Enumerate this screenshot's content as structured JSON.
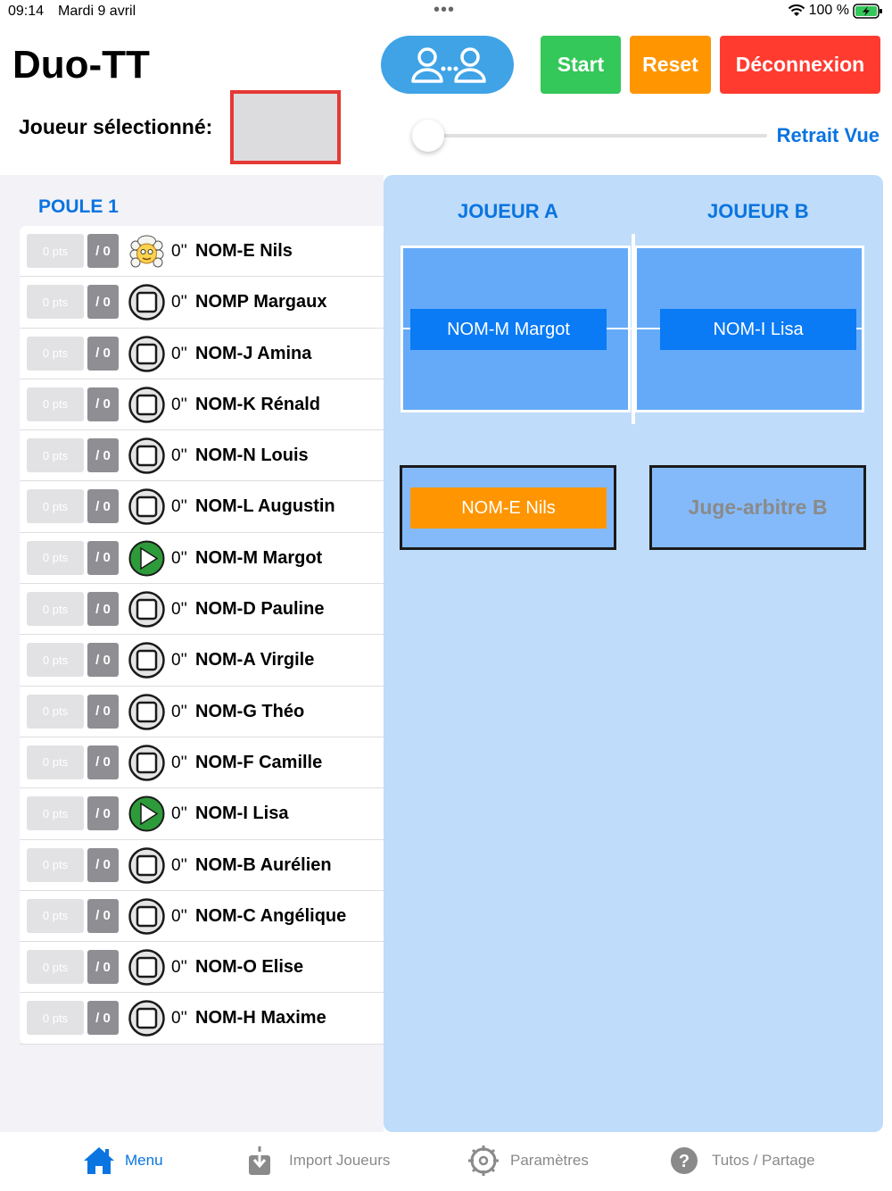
{
  "status_bar": {
    "time": "09:14",
    "date": "Mardi 9 avril",
    "dots": "•••",
    "battery": "100 %"
  },
  "header": {
    "title": "Duo-TT",
    "selected_label": "Joueur sélectionné:",
    "start_label": "Start",
    "reset_label": "Reset",
    "logout_label": "Déconnexion",
    "retrait_label": "Retrait Vue",
    "slider_value": 0
  },
  "pool": {
    "title": "POULE 1",
    "players": [
      {
        "pts": "0 pts",
        "score": "/ 0",
        "time": "0''",
        "name": "NOM-E Nils",
        "status": "judge"
      },
      {
        "pts": "0 pts",
        "score": "/ 0",
        "time": "0''",
        "name": "NOMP Margaux",
        "status": "stop"
      },
      {
        "pts": "0 pts",
        "score": "/ 0",
        "time": "0''",
        "name": "NOM-J Amina",
        "status": "stop"
      },
      {
        "pts": "0 pts",
        "score": "/ 0",
        "time": "0''",
        "name": "NOM-K Rénald",
        "status": "stop"
      },
      {
        "pts": "0 pts",
        "score": "/ 0",
        "time": "0''",
        "name": "NOM-N Louis",
        "status": "stop"
      },
      {
        "pts": "0 pts",
        "score": "/ 0",
        "time": "0''",
        "name": "NOM-L Augustin",
        "status": "stop"
      },
      {
        "pts": "0 pts",
        "score": "/ 0",
        "time": "0''",
        "name": "NOM-M Margot",
        "status": "play"
      },
      {
        "pts": "0 pts",
        "score": "/ 0",
        "time": "0''",
        "name": "NOM-D Pauline",
        "status": "stop"
      },
      {
        "pts": "0 pts",
        "score": "/ 0",
        "time": "0''",
        "name": "NOM-A Virgile",
        "status": "stop"
      },
      {
        "pts": "0 pts",
        "score": "/ 0",
        "time": "0''",
        "name": "NOM-G Théo",
        "status": "stop"
      },
      {
        "pts": "0 pts",
        "score": "/ 0",
        "time": "0''",
        "name": "NOM-F Camille",
        "status": "stop"
      },
      {
        "pts": "0 pts",
        "score": "/ 0",
        "time": "0''",
        "name": "NOM-I Lisa",
        "status": "play"
      },
      {
        "pts": "0 pts",
        "score": "/ 0",
        "time": "0''",
        "name": "NOM-B Aurélien",
        "status": "stop"
      },
      {
        "pts": "0 pts",
        "score": "/ 0",
        "time": "0''",
        "name": "NOM-C Angélique",
        "status": "stop"
      },
      {
        "pts": "0 pts",
        "score": "/ 0",
        "time": "0''",
        "name": "NOM-O Elise",
        "status": "stop"
      },
      {
        "pts": "0 pts",
        "score": "/ 0",
        "time": "0''",
        "name": "NOM-H Maxime",
        "status": "stop"
      }
    ]
  },
  "match": {
    "player_a_title": "JOUEUR A",
    "player_b_title": "JOUEUR B",
    "player_a": "NOM-M Margot",
    "player_b": "NOM-I Lisa",
    "umpire_a": "NOM-E Nils",
    "umpire_b": "Juge-arbitre B"
  },
  "tabs": [
    {
      "label": "Menu",
      "icon": "home-icon",
      "active": true
    },
    {
      "label": "Import Joueurs",
      "icon": "download-icon",
      "active": false
    },
    {
      "label": "Paramètres",
      "icon": "gear-icon",
      "active": false
    },
    {
      "label": "Tutos / Partage",
      "icon": "help-icon",
      "active": false
    }
  ],
  "colors": {
    "accent": "#0a74e0",
    "start": "#34c759",
    "reset": "#ff9500",
    "logout": "#ff3b30",
    "table": "#64aaf9",
    "panel": "#bfdcfa"
  }
}
